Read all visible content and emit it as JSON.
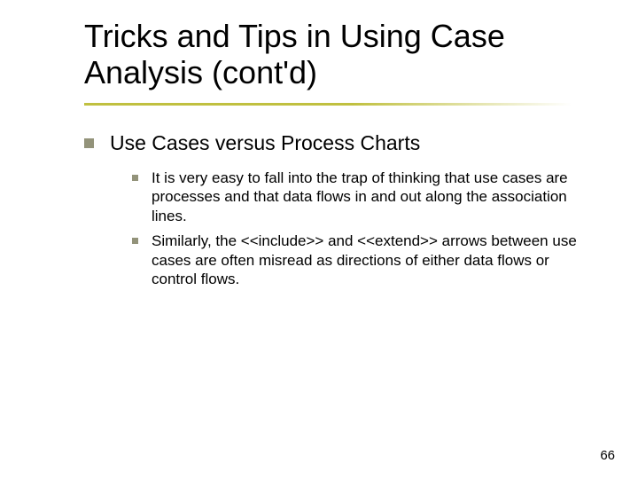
{
  "title": "Tricks and Tips in Using Case Analysis (cont'd)",
  "heading": "Use Cases versus Process Charts",
  "subpoints": [
    "It is very easy to fall into the trap of thinking that use cases are processes and that data flows in and out along the association lines.",
    "Similarly, the <<include>> and <<extend>> arrows between use cases are often misread as directions of either data flows or control flows."
  ],
  "page_number": "66"
}
